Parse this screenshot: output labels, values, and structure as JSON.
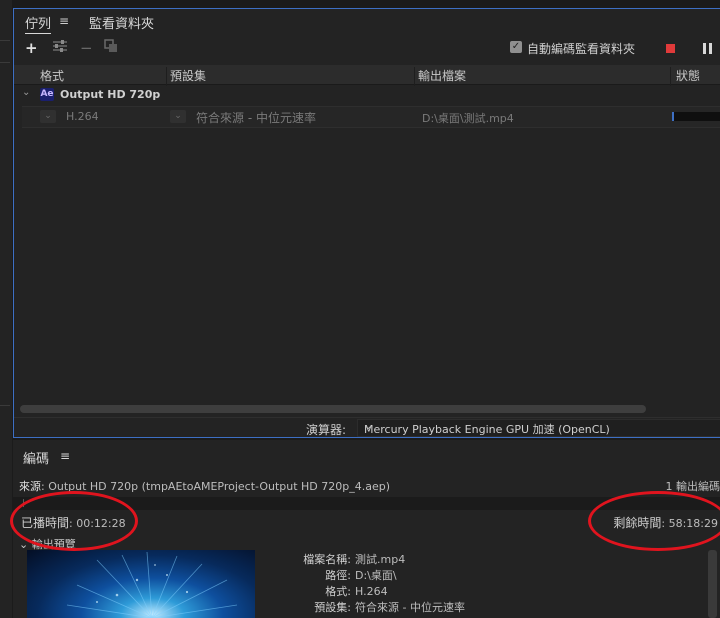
{
  "queue": {
    "tabs": [
      {
        "label": "佇列",
        "active": true
      },
      {
        "label": "監看資料夾",
        "active": false
      }
    ],
    "menu_icon": "≡",
    "toolbar": {
      "add_icon": "plus-icon",
      "settings_icon": "sliders-icon",
      "remove_icon": "minus-icon",
      "duplicate_icon": "duplicate-icon",
      "auto_encode_label": "自動編碼監看資料夾",
      "auto_encode_checked": true,
      "stop_color": "#e03a3a"
    },
    "columns": [
      "格式",
      "預設集",
      "輸出檔案",
      "狀態"
    ],
    "group": {
      "badge": "Ae",
      "name": "Output HD 720p"
    },
    "item": {
      "format": "H.264",
      "preset": "符合來源 - 中位元速率",
      "output": "D:\\桌面\\測試.mp4"
    },
    "renderer": {
      "label": "演算器:",
      "value": "Mercury Playback Engine GPU 加速 (OpenCL)"
    }
  },
  "encoding": {
    "tab": "編碼",
    "menu_icon": "≡",
    "source_label": "來源",
    "source_value": ": Output HD 720p (tmpAEtoAMEProject-Output HD 720p_4.aep)",
    "output_count": "1 輸出編碼",
    "elapsed_label": "已播時間",
    "elapsed_value": ": 00:12:28",
    "remaining_label": "剩餘時間",
    "remaining_value": ": 58:18:29",
    "preview_label": "輸出預覽",
    "meta": {
      "filename_label": "檔案名稱:",
      "filename": "測試.mp4",
      "path_label": "路徑:",
      "path": "D:\\桌面\\",
      "format_label": "格式:",
      "format": "H.264",
      "preset_label": "預設集:",
      "preset": "符合來源 - 中位元速率"
    }
  },
  "colors": {
    "accent": "#3d6fc4",
    "annotation": "#e0141e"
  }
}
